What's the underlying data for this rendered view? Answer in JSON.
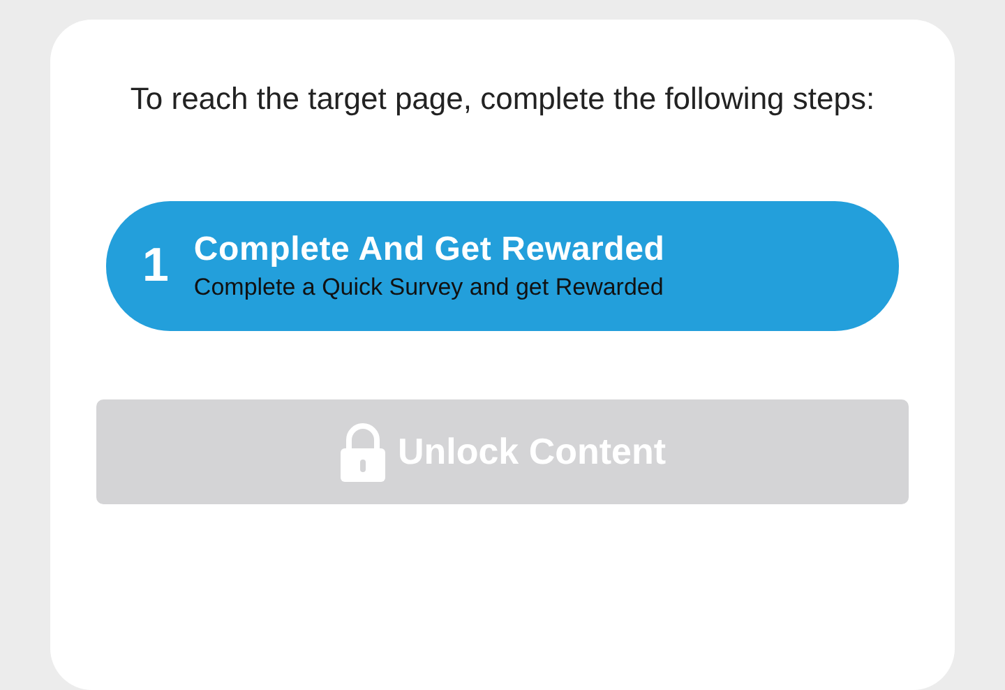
{
  "heading": "To reach the target page, complete the following steps:",
  "steps": [
    {
      "number": "1",
      "title": "Complete And Get Rewarded",
      "subtitle": "Complete a Quick Survey and get Rewarded"
    }
  ],
  "unlock_button": {
    "label": "Unlock Content",
    "disabled": true
  }
}
